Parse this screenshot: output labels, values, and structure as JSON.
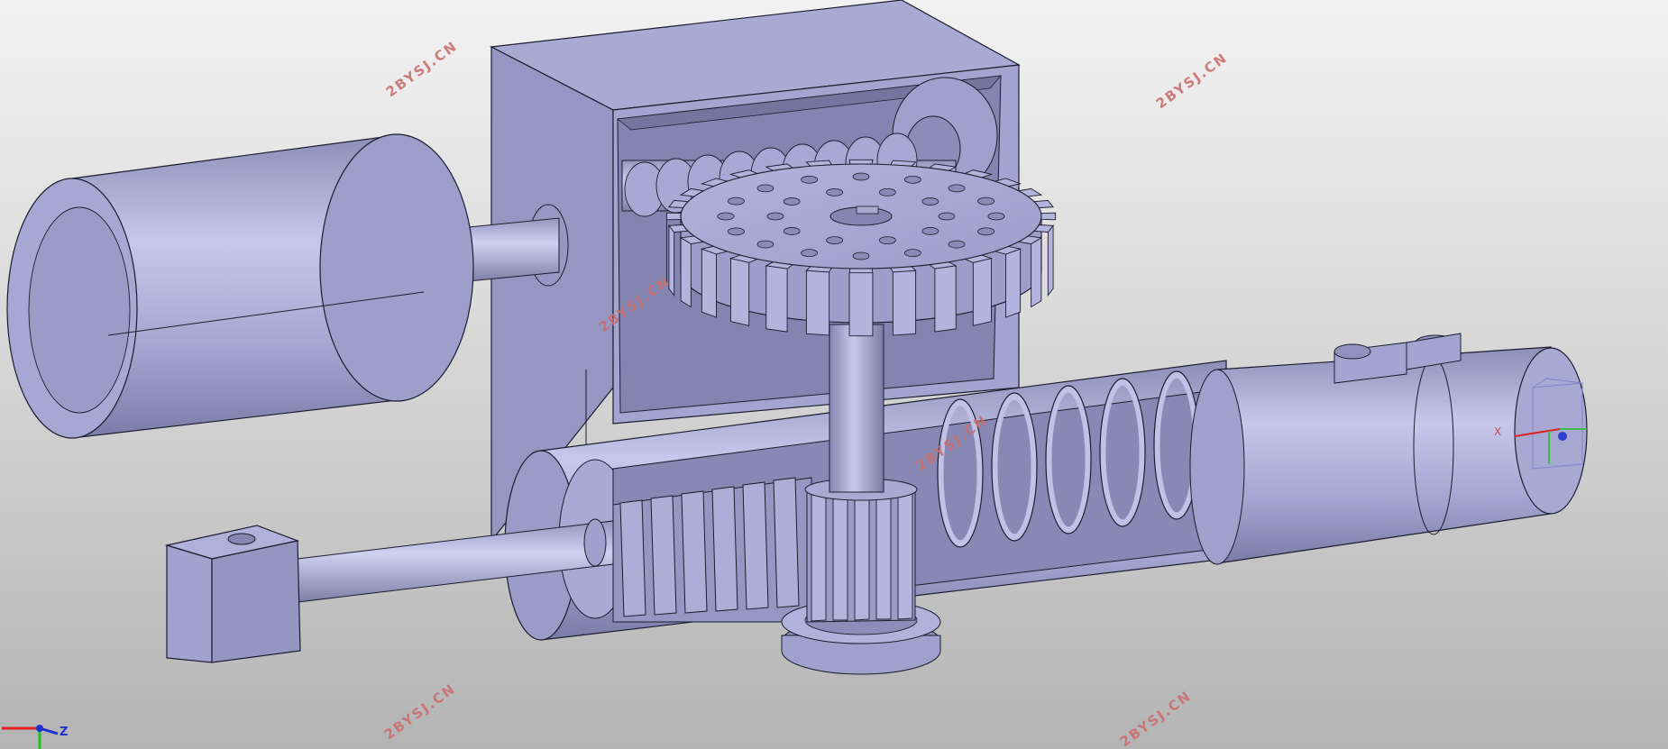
{
  "viewport": {
    "background_top": "#f2f2f2",
    "background_bottom": "#b4b4b4",
    "model_color": "#a8a9d2",
    "edge_color": "#1c1c30"
  },
  "watermarks": [
    {
      "text": "2BYSJ.CN"
    },
    {
      "text": "2BYSJ.CN"
    },
    {
      "text": "2BYSJ.CN"
    },
    {
      "text": "2BYSJ.CN"
    },
    {
      "text": "2BYSJ.CN"
    },
    {
      "text": "2BYSJ.CN"
    }
  ],
  "axis_triad": {
    "z_label": "Z",
    "x_color": "#e02020",
    "y_color": "#20c020",
    "z_color": "#2030d0"
  },
  "view_cube_label": "X"
}
